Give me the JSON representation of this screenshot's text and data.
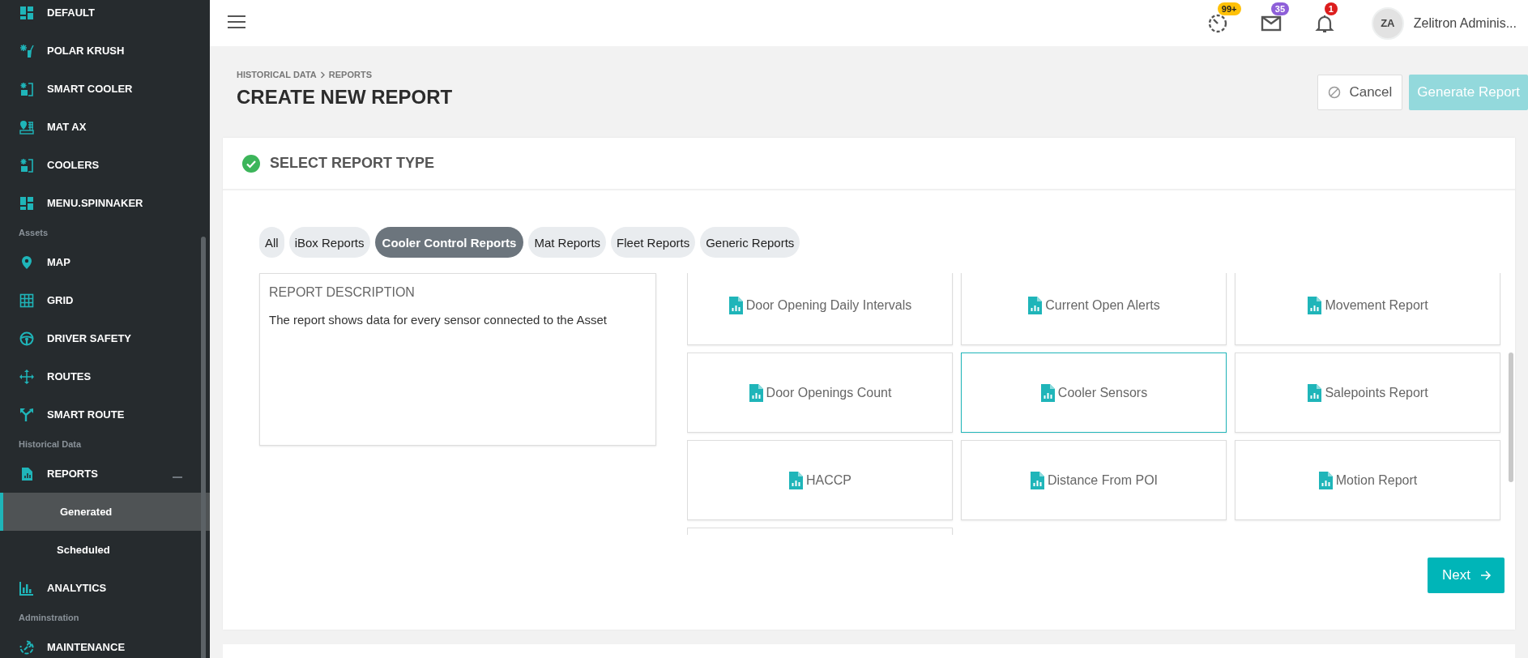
{
  "sidebar": {
    "items": [
      {
        "kind": "dashboard",
        "label": "DEFAULT"
      },
      {
        "kind": "snow-cup",
        "label": "POLAR KRUSH"
      },
      {
        "kind": "fridge",
        "label": "SMART COOLER"
      },
      {
        "kind": "pin-grid",
        "label": "MAT AX"
      },
      {
        "kind": "fridge",
        "label": "COOLERS"
      },
      {
        "kind": "dashboard",
        "label": "MENU.SPINNAKER"
      }
    ],
    "sections": [
      {
        "label": "Assets",
        "items": [
          {
            "kind": "pin",
            "label": "MAP"
          },
          {
            "kind": "grid",
            "label": "GRID"
          },
          {
            "kind": "wheel",
            "label": "DRIVER SAFETY"
          },
          {
            "kind": "move",
            "label": "ROUTES"
          },
          {
            "kind": "fork",
            "label": "SMART ROUTE"
          }
        ]
      },
      {
        "label": "Historical Data",
        "items": [
          {
            "kind": "file-chart",
            "label": "REPORTS",
            "expanded": true,
            "children": [
              {
                "label": "Generated",
                "selected": true
              },
              {
                "label": "Scheduled",
                "selected": false
              }
            ]
          },
          {
            "kind": "bars",
            "label": "ANALYTICS"
          }
        ]
      },
      {
        "label": "Adminstration",
        "items": [
          {
            "kind": "wrench",
            "label": "MAINTENANCE"
          }
        ]
      }
    ]
  },
  "header": {
    "notifications": [
      {
        "kind": "clock",
        "count": "99+",
        "color": "#ffc107"
      },
      {
        "kind": "mail",
        "count": "35",
        "color": "#8e5fd9"
      },
      {
        "kind": "bell",
        "count": "1",
        "color": "#dc1d1d"
      }
    ],
    "avatar": "ZA",
    "user_name": "Zelitron Adminis..."
  },
  "breadcrumb": [
    "HISTORICAL DATA",
    "REPORTS"
  ],
  "title": "CREATE NEW REPORT",
  "buttons": [
    {
      "kind": "cancel",
      "label": "Cancel",
      "disabled": false
    },
    {
      "kind": "primary",
      "label": "Generate Report",
      "disabled": true
    }
  ],
  "step": {
    "title": "SELECT REPORT TYPE",
    "completed": true
  },
  "tabs": [
    {
      "label": "All",
      "selected": false
    },
    {
      "label": "iBox Reports",
      "selected": false
    },
    {
      "label": "Cooler Control Reports",
      "selected": true
    },
    {
      "label": "Mat Reports",
      "selected": false
    },
    {
      "label": "Fleet Reports",
      "selected": false
    },
    {
      "label": "Generic Reports",
      "selected": false
    }
  ],
  "description": {
    "heading": "REPORT DESCRIPTION",
    "text": "The report shows data for every sensor connected to the Asset"
  },
  "reports": [
    {
      "label": "Door Opening Daily Intervals",
      "selected": false
    },
    {
      "label": "Current Open Alerts",
      "selected": false
    },
    {
      "label": "Movement Report",
      "selected": false
    },
    {
      "label": "Door Openings Count",
      "selected": false
    },
    {
      "label": "Cooler Sensors",
      "selected": true
    },
    {
      "label": "Salepoints Report",
      "selected": false
    },
    {
      "label": "HACCP",
      "selected": false
    },
    {
      "label": "Distance From POI",
      "selected": false
    },
    {
      "label": "Motion Report",
      "selected": false
    }
  ],
  "next_button": "Next"
}
